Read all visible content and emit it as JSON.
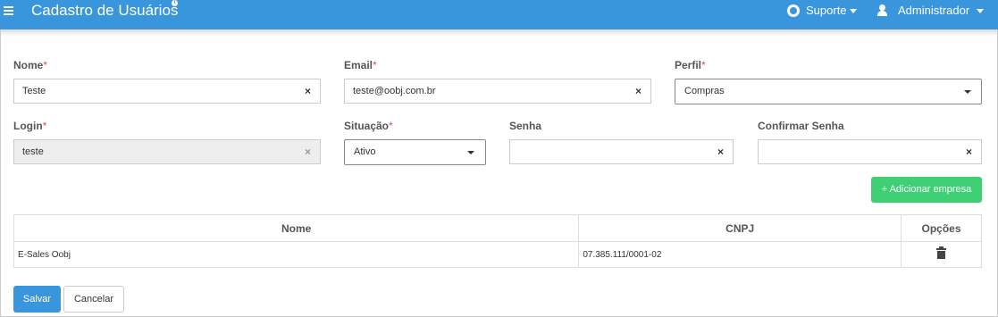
{
  "header": {
    "title": "Cadastro de Usuários",
    "info_badge": "i",
    "support_label": "Suporte",
    "user_label": "Administrador",
    "colors": {
      "bar": "#3a96dc"
    }
  },
  "form": {
    "nome": {
      "label": "Nome",
      "required": "*",
      "value": "Teste",
      "clear": "×"
    },
    "email": {
      "label": "Email",
      "required": "*",
      "value": "teste@oobj.com.br",
      "clear": "×"
    },
    "perfil": {
      "label": "Perfil",
      "required": "*",
      "value": "Compras"
    },
    "login": {
      "label": "Login",
      "required": "*",
      "value": "teste",
      "clear": "×"
    },
    "situacao": {
      "label": "Situação",
      "required": "*",
      "value": "Ativo"
    },
    "senha": {
      "label": "Senha",
      "value": "",
      "clear": "×"
    },
    "confirmar_senha": {
      "label": "Confirmar Senha",
      "value": "",
      "clear": "×"
    }
  },
  "add_company_label": "+ Adicionar empresa",
  "table": {
    "columns": [
      "Nome",
      "CNPJ",
      "Opções"
    ],
    "rows": [
      {
        "nome": "E-Sales Oobj",
        "cnpj": "07.385.111/0001-02",
        "action_icon": "trash-icon"
      }
    ]
  },
  "actions": {
    "save_label": "Salvar",
    "cancel_label": "Cancelar"
  },
  "colors": {
    "primary": "#3a96dc",
    "success": "#3fcf74",
    "required": "#d9534f"
  }
}
